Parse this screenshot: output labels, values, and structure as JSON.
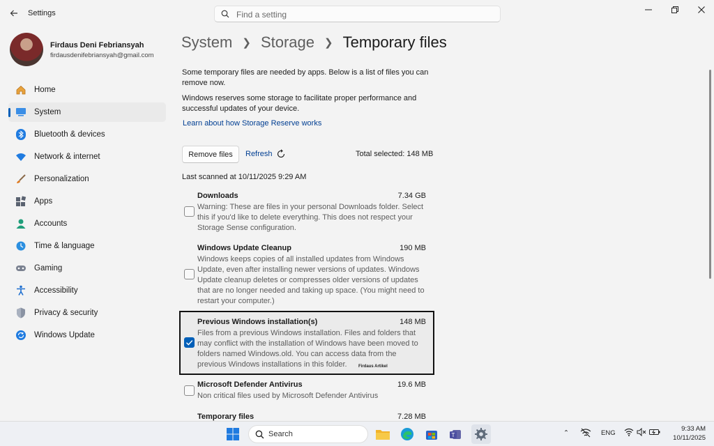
{
  "window": {
    "title": "Settings",
    "search_placeholder": "Find a setting"
  },
  "profile": {
    "name": "Firdaus Deni Febriansyah",
    "email": "firdausdenifebriansyah@gmail.com"
  },
  "sidebar": {
    "items": [
      {
        "label": "Home",
        "icon": "home-icon",
        "active": false
      },
      {
        "label": "System",
        "icon": "system-icon",
        "active": true
      },
      {
        "label": "Bluetooth & devices",
        "icon": "bluetooth-icon",
        "active": false
      },
      {
        "label": "Network & internet",
        "icon": "wifi-icon",
        "active": false
      },
      {
        "label": "Personalization",
        "icon": "brush-icon",
        "active": false
      },
      {
        "label": "Apps",
        "icon": "apps-icon",
        "active": false
      },
      {
        "label": "Accounts",
        "icon": "accounts-icon",
        "active": false
      },
      {
        "label": "Time & language",
        "icon": "globe-clock-icon",
        "active": false
      },
      {
        "label": "Gaming",
        "icon": "gamepad-icon",
        "active": false
      },
      {
        "label": "Accessibility",
        "icon": "accessibility-icon",
        "active": false
      },
      {
        "label": "Privacy & security",
        "icon": "shield-icon",
        "active": false
      },
      {
        "label": "Windows Update",
        "icon": "update-icon",
        "active": false
      }
    ]
  },
  "breadcrumb": {
    "items": [
      "System",
      "Storage"
    ],
    "current": "Temporary files"
  },
  "intro": {
    "p1": "Some temporary files are needed by apps. Below is a list of files you can remove now.",
    "p2": "Windows reserves some storage to facilitate proper performance and successful updates of your device.",
    "link": "Learn about how Storage Reserve works"
  },
  "actions": {
    "remove_label": "Remove files",
    "refresh_label": "Refresh",
    "total_selected": "Total selected: 148 MB"
  },
  "last_scanned": "Last scanned at 10/11/2025 9:29 AM",
  "files": [
    {
      "title": "Downloads",
      "size": "7.34 GB",
      "checked": false,
      "desc": "Warning: These are files in your personal Downloads folder. Select this if you'd like to delete everything. This does not respect your Storage Sense configuration."
    },
    {
      "title": "Windows Update Cleanup",
      "size": "190 MB",
      "checked": false,
      "desc": "Windows keeps copies of all installed updates from Windows Update, even after installing newer versions of updates. Windows Update cleanup deletes or compresses older versions of updates that are no longer needed and taking up space. (You might need to restart your computer.)"
    },
    {
      "title": "Previous Windows installation(s)",
      "size": "148 MB",
      "checked": true,
      "desc": "Files from a previous Windows installation.  Files and folders that may conflict with the installation of Windows have been moved to folders named Windows.old.  You can access data from the previous Windows installations in this folder."
    },
    {
      "title": "Microsoft Defender Antivirus",
      "size": "19.6 MB",
      "checked": false,
      "desc": "Non critical files used by Microsoft Defender Antivirus"
    },
    {
      "title": "Temporary files",
      "size": "7.28 MB",
      "checked": false,
      "desc": ""
    }
  ],
  "watermark": "Firdaus Artikel",
  "taskbar": {
    "search_label": "Search",
    "lang": "ENG",
    "time": "9:33 AM",
    "date": "10/11/2025"
  },
  "colors": {
    "accent": "#005fb8",
    "link": "#003e92",
    "background": "#f3f3f3"
  }
}
